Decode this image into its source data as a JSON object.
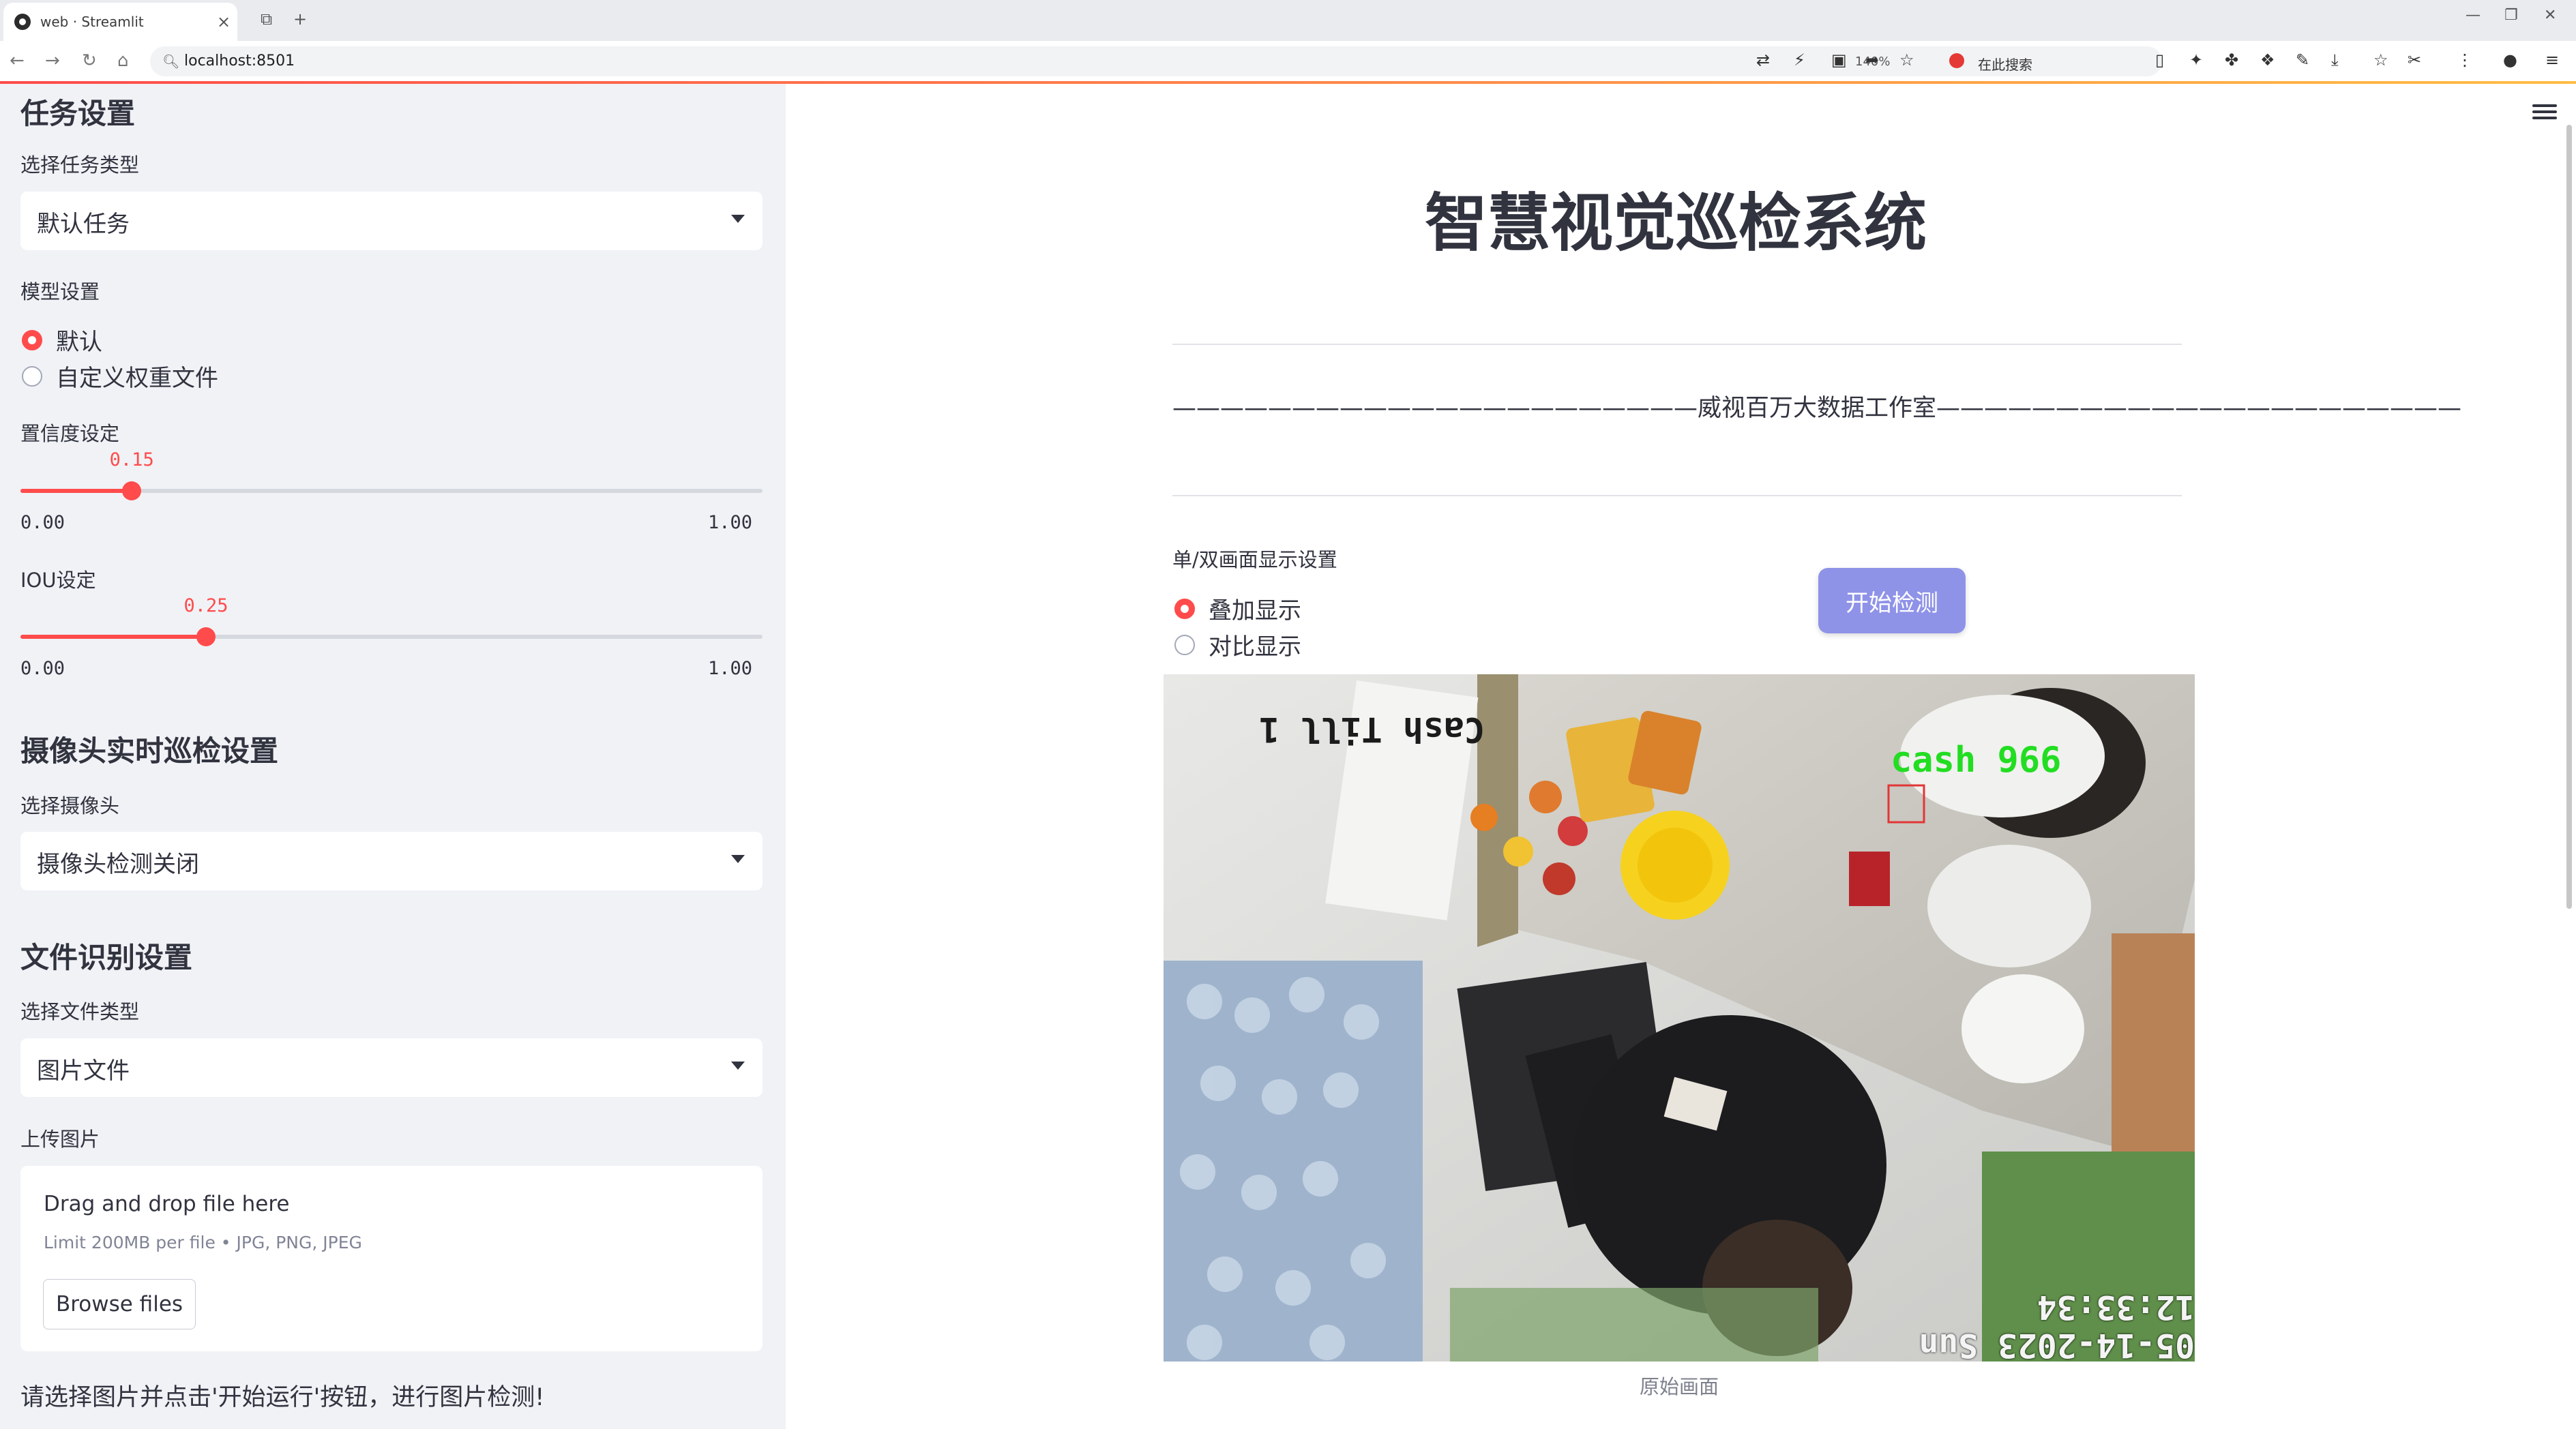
{
  "browser": {
    "tab_title": "web · Streamlit",
    "url": "localhost:8501",
    "zoom": "140%",
    "search_placeholder": "在此搜索"
  },
  "sidebar": {
    "task_heading": "任务设置",
    "task_type_label": "选择任务类型",
    "task_type_value": "默认任务",
    "model_label": "模型设置",
    "model_options": [
      "默认",
      "自定义权重文件"
    ],
    "model_selected": 0,
    "confidence": {
      "label": "置信度设定",
      "value": 0.15,
      "display": "0.15",
      "min": "0.00",
      "max": "1.00"
    },
    "iou": {
      "label": "IOU设定",
      "value": 0.25,
      "display": "0.25",
      "min": "0.00",
      "max": "1.00"
    },
    "camera_heading": "摄像头实时巡检设置",
    "camera_label": "选择摄像头",
    "camera_value": "摄像头检测关闭",
    "file_heading": "文件识别设置",
    "file_type_label": "选择文件类型",
    "file_type_value": "图片文件",
    "upload_label": "上传图片",
    "uploader": {
      "title": "Drag and drop file here",
      "limit": "Limit 200MB per file • JPG, PNG, JPEG",
      "button": "Browse files"
    },
    "hint": "请选择图片并点击'开始运行'按钮，进行图片检测!"
  },
  "main": {
    "title": "智慧视觉巡检系统",
    "studio_line": "——————————————————————威视百万大数据工作室——————————————————————",
    "display_label": "单/双画面显示设置",
    "display_options": [
      "叠加显示",
      "对比显示"
    ],
    "display_selected": 0,
    "start_button": "开始检测",
    "image": {
      "overlay_top": "Cash Till 1",
      "timestamp": "05-14-2023 Sun 12:33:34",
      "detection_label": "cash 966",
      "caption": "原始画面"
    }
  },
  "colors": {
    "accent": "#ff4b4b",
    "sidebar_bg": "#f0f2f6",
    "button": "#8f93e8",
    "detection": "#22dd22"
  }
}
